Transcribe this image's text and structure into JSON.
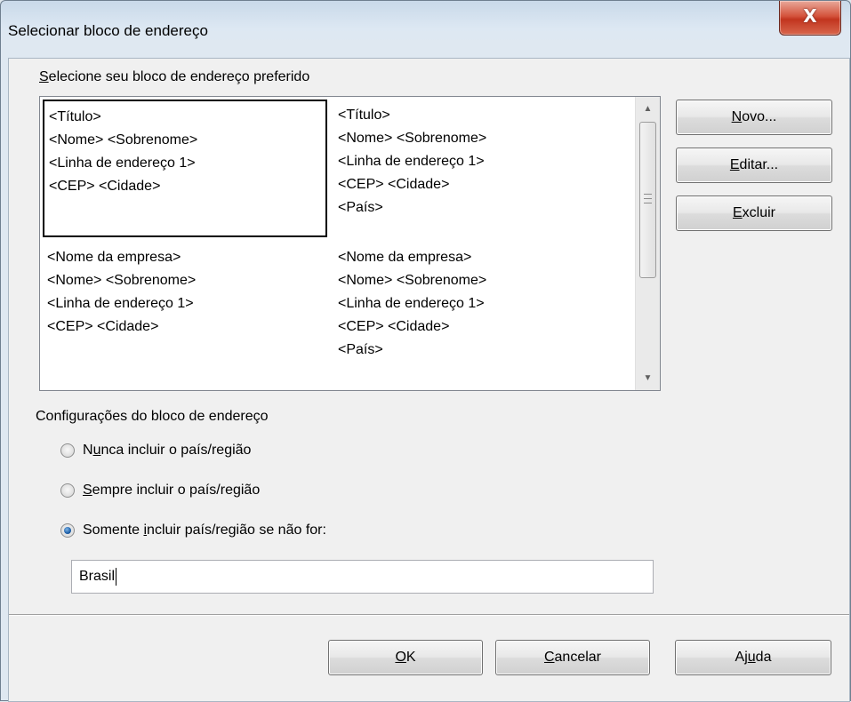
{
  "window": {
    "title": "Selecionar bloco de endereço",
    "close_symbol": "X"
  },
  "address_blocks": {
    "label_prefix": "S",
    "label_rest": "elecione seu bloco de endereço preferido",
    "blocks": [
      {
        "lines": [
          "<Título>",
          "<Nome> <Sobrenome>",
          "<Linha de endereço 1>",
          "<CEP> <Cidade>"
        ],
        "selected": true
      },
      {
        "lines": [
          "<Título>",
          "<Nome> <Sobrenome>",
          "<Linha de endereço 1>",
          "<CEP> <Cidade>",
          "<País>"
        ],
        "selected": false
      },
      {
        "lines": [
          "<Nome da empresa>",
          "<Nome> <Sobrenome>",
          "<Linha de endereço 1>",
          "<CEP> <Cidade>"
        ],
        "selected": false
      },
      {
        "lines": [
          "<Nome da empresa>",
          "<Nome> <Sobrenome>",
          "<Linha de endereço 1>",
          "<CEP> <Cidade>",
          "<País>"
        ],
        "selected": false
      }
    ]
  },
  "side_buttons": {
    "novo": {
      "mnemonic": "N",
      "rest": "ovo..."
    },
    "editar": {
      "mnemonic": "E",
      "rest": "ditar..."
    },
    "excluir": {
      "mnemonic": "E",
      "rest": "xcluir"
    }
  },
  "config": {
    "label": "Configurações do bloco de endereço",
    "options": [
      {
        "pre": "N",
        "mnemonic": "u",
        "post": "nca incluir o país/região",
        "checked": false
      },
      {
        "pre": "",
        "mnemonic": "S",
        "post": "empre incluir o país/região",
        "checked": false
      },
      {
        "pre": "Somente ",
        "mnemonic": "i",
        "post": "ncluir país/região se não for:",
        "checked": true
      }
    ],
    "country_value": "Brasil"
  },
  "footer": {
    "ok": {
      "mnemonic": "O",
      "rest": "K"
    },
    "cancel": {
      "mnemonic": "C",
      "rest": "ancelar"
    },
    "help": {
      "pre": "Aj",
      "mnemonic": "u",
      "post": "da"
    }
  }
}
